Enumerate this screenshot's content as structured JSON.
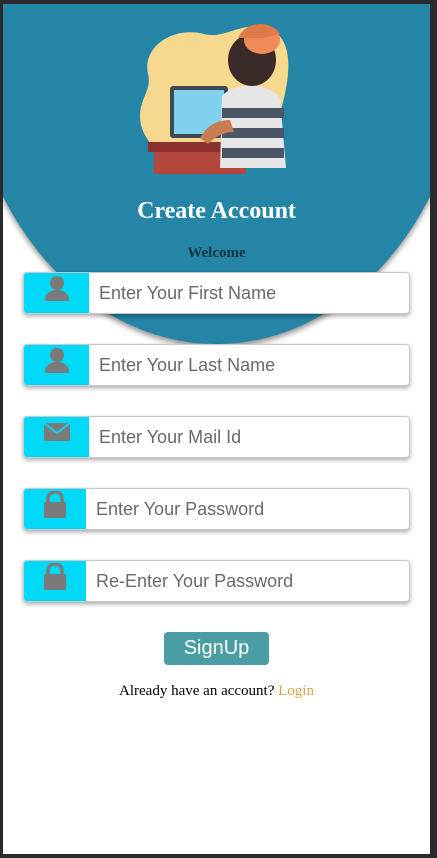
{
  "header": {
    "title": "Create Account",
    "subtitle": "Welcome",
    "color": "#2485a6"
  },
  "form": {
    "first_name_placeholder": "Enter Your First Name",
    "last_name_placeholder": "Enter Your Last Name",
    "mail_placeholder": "Enter Your Mail Id",
    "password_placeholder": "Enter Your Password",
    "reenter_password_placeholder": "Re-Enter Your Password",
    "icon_bg_color": "#00d8f8",
    "icons": [
      "user-icon",
      "user-icon",
      "envelope-icon",
      "lock-icon",
      "lock-icon"
    ]
  },
  "signup_button": {
    "label": "SignUp",
    "color": "#4a9ea3"
  },
  "footer": {
    "question": "Already have an account? ",
    "login_link": "Login",
    "link_color": "#d6a44a"
  }
}
